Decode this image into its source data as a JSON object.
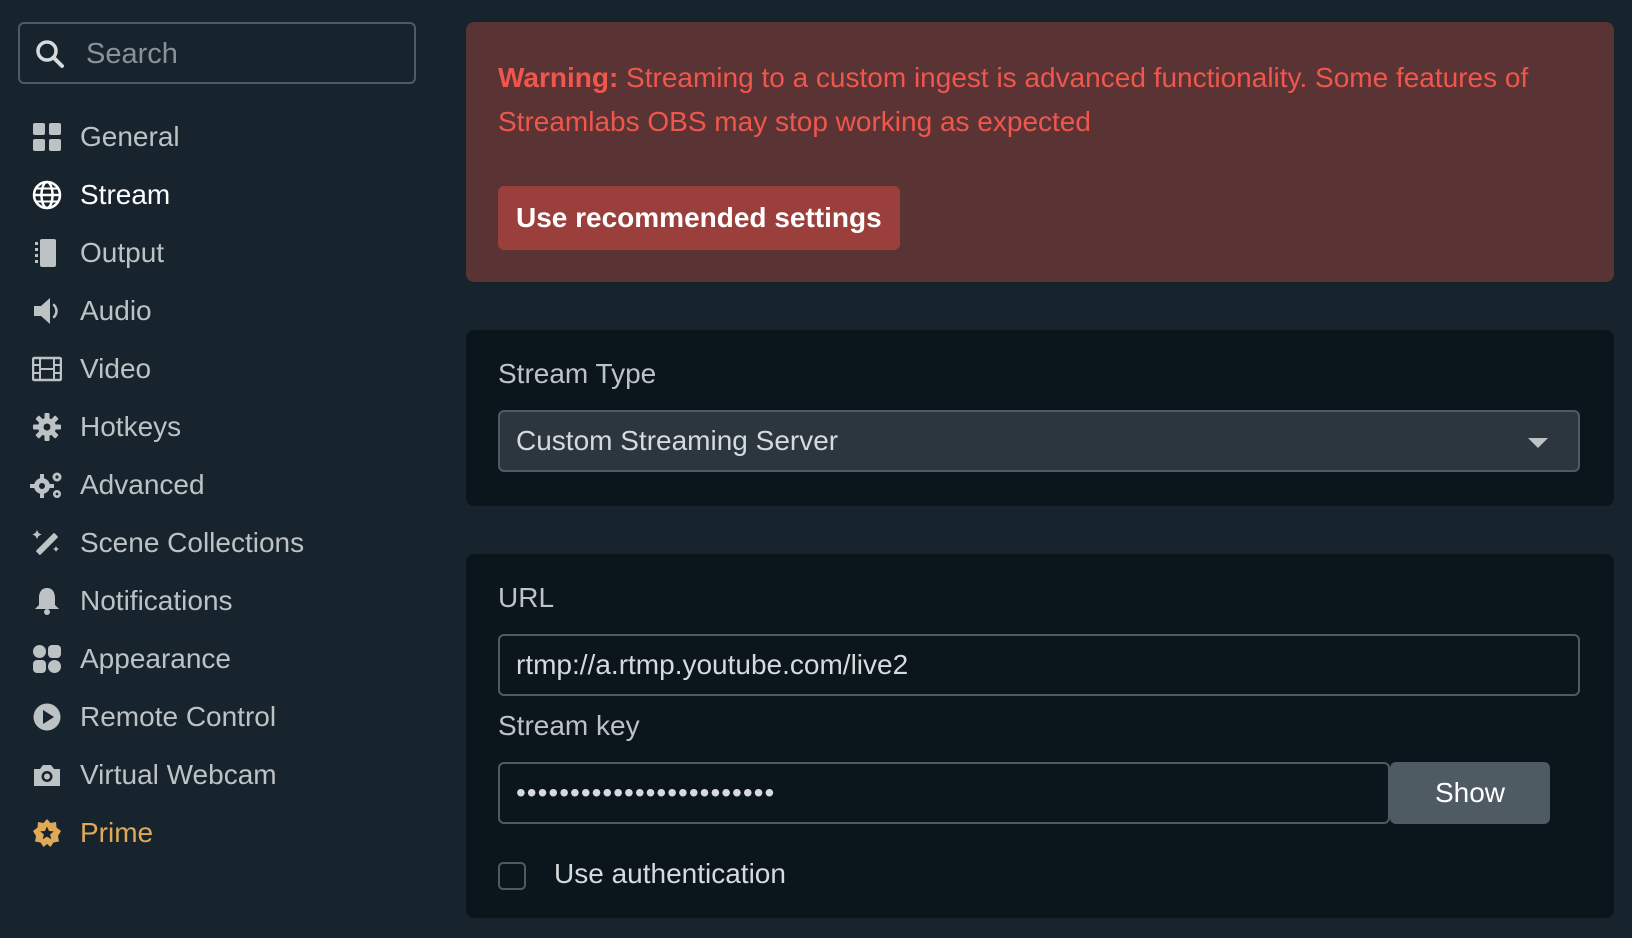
{
  "search": {
    "placeholder": "Search"
  },
  "sidebar": {
    "items": [
      {
        "label": "General",
        "icon": "grid-icon"
      },
      {
        "label": "Stream",
        "icon": "globe-icon",
        "active": true
      },
      {
        "label": "Output",
        "icon": "chip-icon"
      },
      {
        "label": "Audio",
        "icon": "speaker-icon"
      },
      {
        "label": "Video",
        "icon": "film-icon"
      },
      {
        "label": "Hotkeys",
        "icon": "gear-icon"
      },
      {
        "label": "Advanced",
        "icon": "gears-icon"
      },
      {
        "label": "Scene Collections",
        "icon": "magic-wand-icon"
      },
      {
        "label": "Notifications",
        "icon": "bell-icon"
      },
      {
        "label": "Appearance",
        "icon": "shapes-icon"
      },
      {
        "label": "Remote Control",
        "icon": "play-circle-icon"
      },
      {
        "label": "Virtual Webcam",
        "icon": "camera-icon"
      },
      {
        "label": "Prime",
        "icon": "prime-badge-icon"
      }
    ]
  },
  "warning": {
    "strong": "Warning:",
    "text": " Streaming to a custom ingest is advanced functionality. Some features of Streamlabs OBS may stop working as expected",
    "button_label": "Use recommended settings"
  },
  "stream_type": {
    "label": "Stream Type",
    "selected": "Custom Streaming Server"
  },
  "server": {
    "url_label": "URL",
    "url_value": "rtmp://a.rtmp.youtube.com/live2",
    "key_label": "Stream key",
    "key_value": "••••••••••••••••••••••••",
    "show_label": "Show",
    "auth_label": "Use authentication"
  },
  "colors": {
    "background": "#17242d",
    "card": "#0b151c",
    "warning_bg": "#5a3334",
    "warning_text": "#f0564c",
    "warning_button": "#9b3f3c",
    "prime": "#dfa957"
  }
}
